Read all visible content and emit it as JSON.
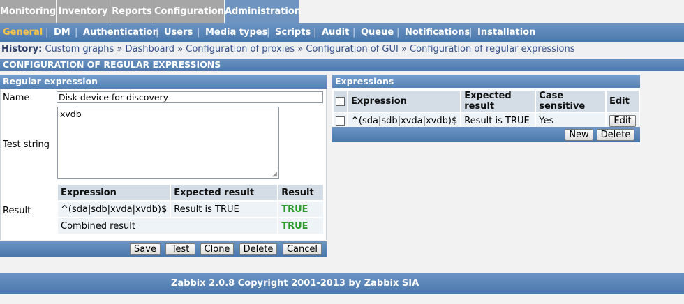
{
  "topmenu": {
    "tabs": [
      {
        "label": "Monitoring"
      },
      {
        "label": "Inventory"
      },
      {
        "label": "Reports"
      },
      {
        "label": "Configuration"
      },
      {
        "label": "Administration"
      }
    ],
    "active_index": 4
  },
  "submenu": {
    "items": [
      {
        "label": "General"
      },
      {
        "label": "DM"
      },
      {
        "label": "Authentication"
      },
      {
        "label": "Users"
      },
      {
        "label": "Media types"
      },
      {
        "label": "Scripts"
      },
      {
        "label": "Audit"
      },
      {
        "label": "Queue"
      },
      {
        "label": "Notifications"
      },
      {
        "label": "Installation"
      }
    ],
    "active_index": 0,
    "separator": "|"
  },
  "history": {
    "label": "History:",
    "links": [
      "Custom graphs",
      "Dashboard",
      "Configuration of proxies",
      "Configuration of GUI",
      "Configuration of regular expressions"
    ],
    "arrow": "»"
  },
  "page_title": "CONFIGURATION OF REGULAR EXPRESSIONS",
  "regex_panel": {
    "title": "Regular expression",
    "name_label": "Name",
    "name_value": "Disk device for discovery",
    "test_string_label": "Test string",
    "test_string_value": "xvdb",
    "result_label": "Result",
    "result_table": {
      "headers": [
        "Expression",
        "Expected result",
        "Result"
      ],
      "row": {
        "expression": "^(sda|sdb|xvda|xvdb)$",
        "expected": "Result is TRUE",
        "result": "TRUE"
      },
      "combined_label": "Combined result",
      "combined_result": "TRUE"
    },
    "buttons": {
      "save": "Save",
      "test": "Test",
      "clone": "Clone",
      "delete": "Delete",
      "cancel": "Cancel"
    }
  },
  "expressions_panel": {
    "title": "Expressions",
    "headers": [
      "Expression",
      "Expected result",
      "Case sensitive",
      "Edit"
    ],
    "rows": [
      {
        "expression": "^(sda|sdb|xvda|xvdb)$",
        "expected": "Result is TRUE",
        "case_sensitive": "Yes",
        "edit": "Edit"
      }
    ],
    "buttons": {
      "new": "New",
      "delete": "Delete"
    }
  },
  "footer": "Zabbix 2.0.8 Copyright 2001-2013 by Zabbix SIA",
  "colors": {
    "active_tab": "#6f94bf",
    "inactive_tab": "#a6a6a6",
    "active_submenu_item": "#f5c348",
    "true_text": "#2a9a2a",
    "bar_blue": "#4a77ab"
  }
}
